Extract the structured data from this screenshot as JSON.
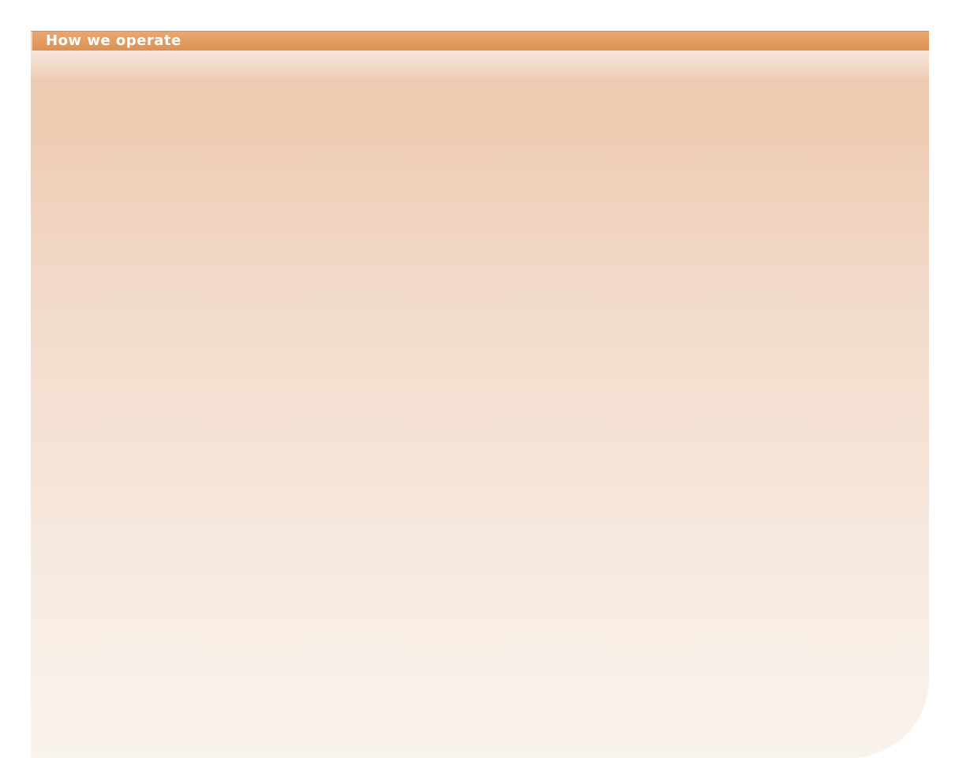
{
  "header": {
    "title": "How we operate"
  },
  "colors": {
    "header_bar": "#e49d62",
    "panel_top": "#ecc8ae",
    "panel_bottom": "#f9f3ed",
    "title_text": "#ffffff"
  }
}
